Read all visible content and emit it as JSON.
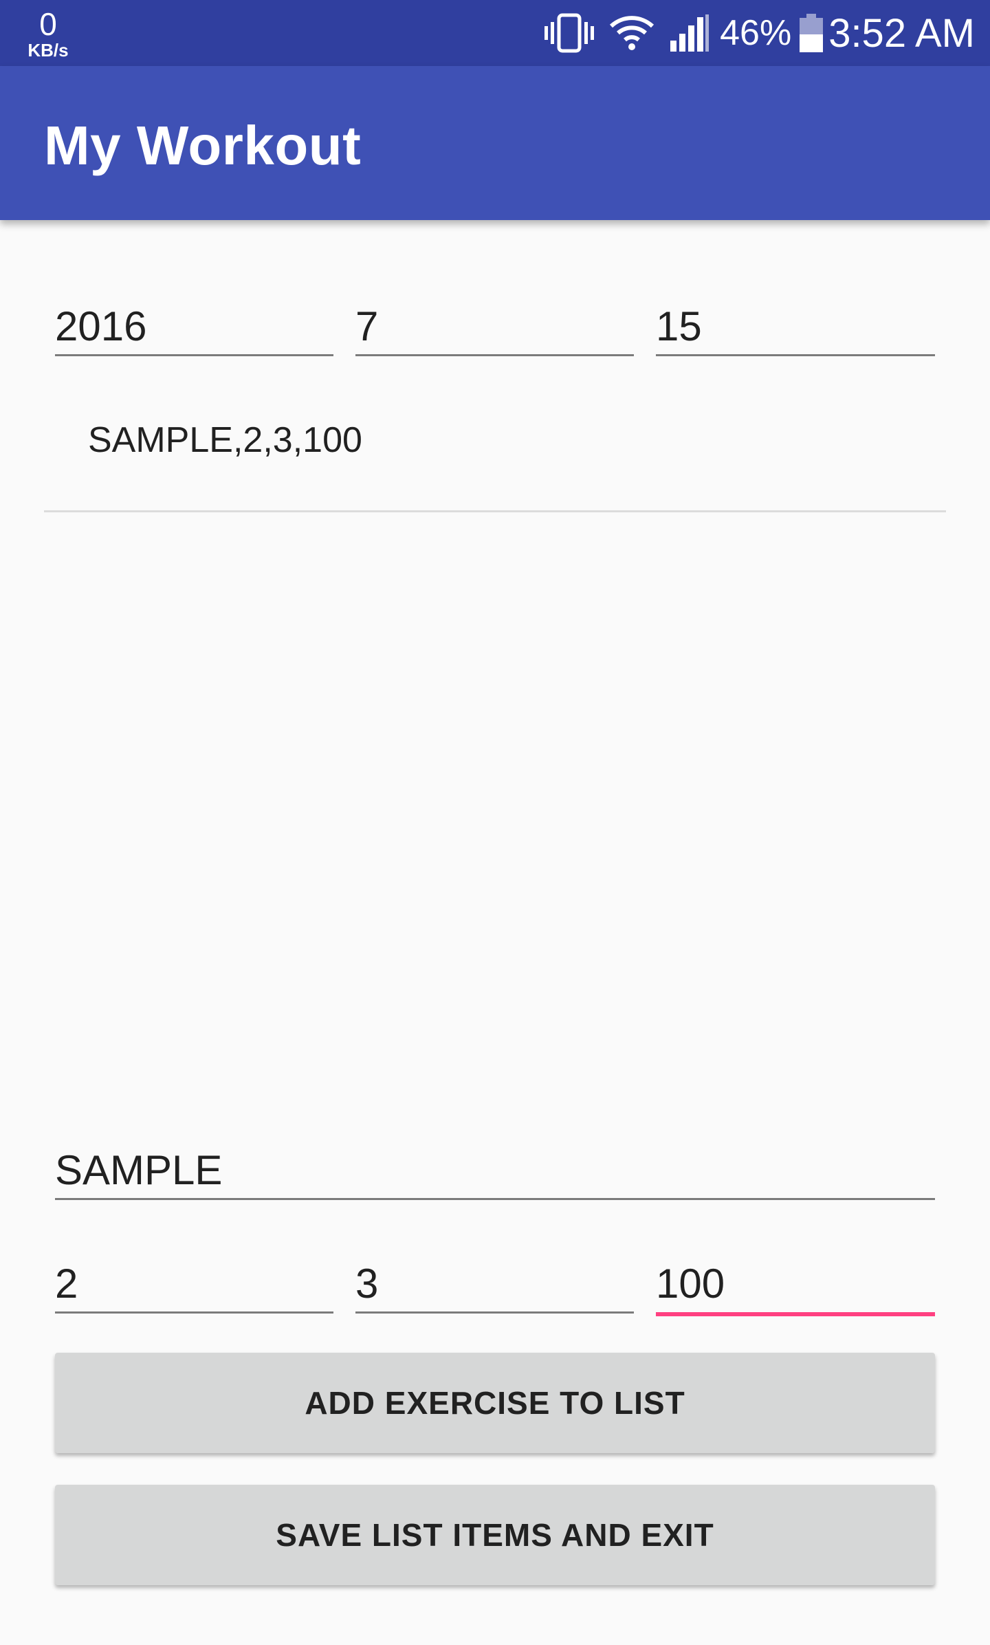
{
  "status_bar": {
    "net_speed_value": "0",
    "net_speed_unit": "KB/s",
    "battery": "46%",
    "time": "3:52 AM",
    "icons": [
      "vibrate-icon",
      "wifi-icon",
      "signal-icon",
      "battery-icon"
    ]
  },
  "app_bar": {
    "title": "My Workout"
  },
  "date": {
    "year": "2016",
    "month": "7",
    "day": "15"
  },
  "exercise_list": {
    "items": [
      "SAMPLE,2,3,100"
    ]
  },
  "form": {
    "name": "SAMPLE",
    "sets": "2",
    "reps": "3",
    "weight": "100"
  },
  "buttons": {
    "add": "ADD EXERCISE TO LIST",
    "save": "SAVE LIST ITEMS AND EXIT"
  },
  "colors": {
    "status_bar": "#303f9f",
    "app_bar": "#3f51b5",
    "accent": "#ff4081",
    "background": "#fafafa",
    "button": "#d6d7d7"
  }
}
